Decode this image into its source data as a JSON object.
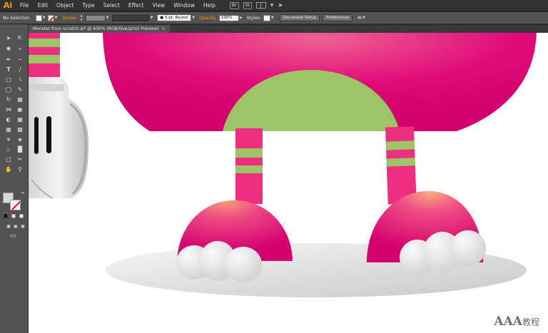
{
  "app": {
    "logo": "Ai"
  },
  "menubar": {
    "items": [
      "File",
      "Edit",
      "Object",
      "Type",
      "Select",
      "Effect",
      "View",
      "Window",
      "Help"
    ],
    "bridge_label": "Br",
    "stock_label": "St",
    "arrange_caret": "▼",
    "send_icon": "send-icon"
  },
  "control": {
    "selection": "No Selection",
    "stroke_label": "Stroke:",
    "brush": "5 pt. Round",
    "opacity_label": "Opacity:",
    "opacity_value": "100%",
    "styles_label": "Styles:",
    "document_setup": "Document Setup",
    "preferences": "Preferences"
  },
  "document": {
    "tab_label": "Monster from scratch.ai* @ 400% (RGB/Overprint Preview)",
    "close_glyph": "×"
  },
  "watermark": {
    "text": "AAA",
    "suffix": "教程"
  },
  "colors": {
    "body_magenta": "#d5006e",
    "accent_green": "#9cc565",
    "leg_pink": "#ee2f80",
    "toe_gray": "#dcdcdc",
    "ui_orange": "#ff9a00"
  }
}
